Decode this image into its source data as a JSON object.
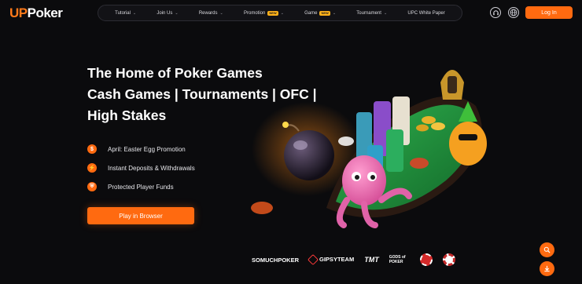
{
  "logo": {
    "up": "UP",
    "poker": "Poker"
  },
  "nav": {
    "items": [
      {
        "label": "Tutorial",
        "dropdown": true,
        "badge": ""
      },
      {
        "label": "Join Us",
        "dropdown": true,
        "badge": ""
      },
      {
        "label": "Rewards",
        "dropdown": true,
        "badge": ""
      },
      {
        "label": "Promotion",
        "dropdown": true,
        "badge": "NEW"
      },
      {
        "label": "Game",
        "dropdown": true,
        "badge": "NEW"
      },
      {
        "label": "Tournament",
        "dropdown": true,
        "badge": ""
      },
      {
        "label": "UPC White Paper",
        "dropdown": false,
        "badge": ""
      }
    ]
  },
  "header": {
    "login_label": "Log In",
    "support_icon": "headset-icon",
    "language_icon": "globe-icon"
  },
  "hero": {
    "line1": "The Home of Poker Games",
    "line2": "Cash Games | Tournaments | OFC |",
    "line3": "High Stakes",
    "features": [
      {
        "icon": "dollar-icon",
        "glyph": "$",
        "text": "April: Easter Egg Promotion"
      },
      {
        "icon": "lightning-icon",
        "glyph": "⚡",
        "text": "Instant Deposits & Withdrawals"
      },
      {
        "icon": "shield-icon",
        "glyph": "⛨",
        "text": "Protected Player Funds"
      }
    ],
    "cta_label": "Play in Browser"
  },
  "partners": {
    "somuch": "SOMUCHPOKER",
    "gipsy": "GIPSYTEAM",
    "tmt": "TMT",
    "gods": "GODS of POKER"
  },
  "colors": {
    "accent": "#ff6a10",
    "background": "#0b0b0d",
    "table": "#1e8a3a"
  }
}
